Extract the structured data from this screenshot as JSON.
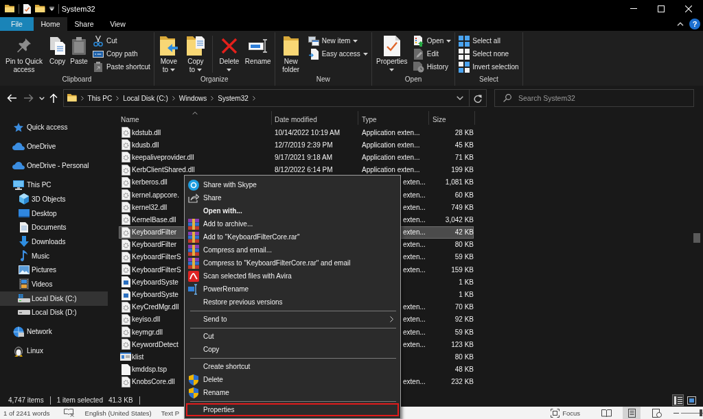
{
  "title_bar": {
    "title": "System32"
  },
  "ribbon_tabs": [
    {
      "label": "File",
      "kind": "file",
      "selected": false
    },
    {
      "label": "Home",
      "kind": "tab",
      "selected": true
    },
    {
      "label": "Share",
      "kind": "tab",
      "selected": false
    },
    {
      "label": "View",
      "kind": "tab",
      "selected": false
    }
  ],
  "help_button": {
    "label": "?"
  },
  "ribbon_groups": [
    {
      "label": "Clipboard",
      "items": [
        {
          "label": "Pin to Quick access",
          "kind": "large",
          "dropdown": false
        },
        {
          "label": "Copy",
          "kind": "large",
          "dropdown": false
        },
        {
          "label": "Paste",
          "kind": "large",
          "dropdown": false
        },
        {
          "label": "Cut",
          "kind": "small",
          "dropdown": false
        },
        {
          "label": "Copy path",
          "kind": "small",
          "dropdown": false
        },
        {
          "label": "Paste shortcut",
          "kind": "small",
          "dropdown": false
        }
      ]
    },
    {
      "label": "Organize",
      "items": [
        {
          "label": "Move to",
          "kind": "large",
          "dropdown": true
        },
        {
          "label": "Copy to",
          "kind": "large",
          "dropdown": true
        },
        {
          "label": "Delete",
          "kind": "large",
          "dropdown": true
        },
        {
          "label": "Rename",
          "kind": "large",
          "dropdown": false
        }
      ]
    },
    {
      "label": "New",
      "items": [
        {
          "label": "New folder",
          "kind": "large",
          "dropdown": false
        },
        {
          "label": "New item",
          "kind": "small",
          "dropdown": true
        },
        {
          "label": "Easy access",
          "kind": "small",
          "dropdown": true
        }
      ]
    },
    {
      "label": "Open",
      "items": [
        {
          "label": "Properties",
          "kind": "large",
          "dropdown": true
        },
        {
          "label": "Open",
          "kind": "small",
          "dropdown": true
        },
        {
          "label": "Edit",
          "kind": "small",
          "dropdown": false
        },
        {
          "label": "History",
          "kind": "small",
          "dropdown": false
        }
      ]
    },
    {
      "label": "Select",
      "items": [
        {
          "label": "Select all",
          "kind": "small",
          "dropdown": false
        },
        {
          "label": "Select none",
          "kind": "small",
          "dropdown": false
        },
        {
          "label": "Invert selection",
          "kind": "small",
          "dropdown": false
        }
      ]
    }
  ],
  "address_bar": {
    "path": [
      "This PC",
      "Local Disk (C:)",
      "Windows",
      "System32"
    ]
  },
  "search": {
    "placeholder": "Search System32"
  },
  "sidebar": {
    "items": [
      {
        "label": "Quick access",
        "selected": false
      },
      {
        "label": "OneDrive",
        "selected": false
      },
      {
        "label": "OneDrive - Personal",
        "selected": false
      },
      {
        "label": "This PC",
        "selected": false,
        "children": [
          {
            "label": "3D Objects",
            "selected": false
          },
          {
            "label": "Desktop",
            "selected": false
          },
          {
            "label": "Documents",
            "selected": false
          },
          {
            "label": "Downloads",
            "selected": false
          },
          {
            "label": "Music",
            "selected": false
          },
          {
            "label": "Pictures",
            "selected": false
          },
          {
            "label": "Videos",
            "selected": false
          },
          {
            "label": "Local Disk (C:)",
            "selected": true
          },
          {
            "label": "Local Disk (D:)",
            "selected": false
          }
        ]
      },
      {
        "label": "Network",
        "selected": false
      },
      {
        "label": "Linux",
        "selected": false
      }
    ]
  },
  "file_list": {
    "columns": [
      {
        "label": "Name",
        "sorted": true
      },
      {
        "label": "Date modified",
        "sorted": false
      },
      {
        "label": "Type",
        "sorted": false
      },
      {
        "label": "Size",
        "sorted": false
      }
    ],
    "rows": [
      {
        "kind": "dll",
        "name": "kdstub.dll",
        "date": "10/14/2022 10:19 AM",
        "type": "Application exten...",
        "size": "28 KB",
        "selected": false
      },
      {
        "kind": "dll",
        "name": "kdusb.dll",
        "date": "12/7/2019 2:39 PM",
        "type": "Application exten...",
        "size": "45 KB",
        "selected": false
      },
      {
        "kind": "dll",
        "name": "keepaliveprovider.dll",
        "date": "9/17/2021 9:18 AM",
        "type": "Application exten...",
        "size": "71 KB",
        "selected": false
      },
      {
        "kind": "dll",
        "name": "KerbClientShared.dll",
        "date": "8/12/2022 6:14 PM",
        "type": "Application exten...",
        "size": "199 KB",
        "selected": false
      },
      {
        "kind": "dll",
        "name": "kerberos.dll",
        "type": "exten...",
        "size": "1,081 KB",
        "selected": false
      },
      {
        "kind": "dll",
        "name": "kernel.appcore.",
        "type": "exten...",
        "size": "60 KB",
        "selected": false
      },
      {
        "kind": "dll",
        "name": "kernel32.dll",
        "type": "exten...",
        "size": "749 KB",
        "selected": false
      },
      {
        "kind": "dll",
        "name": "KernelBase.dll",
        "type": "exten...",
        "size": "3,042 KB",
        "selected": false
      },
      {
        "kind": "dll",
        "name": "KeyboardFilter",
        "type": "exten...",
        "size": "42 KB",
        "selected": true
      },
      {
        "kind": "dll",
        "name": "KeyboardFilter",
        "type": "exten...",
        "size": "80 KB",
        "selected": false
      },
      {
        "kind": "dll",
        "name": "KeyboardFilterS",
        "type": "exten...",
        "size": "59 KB",
        "selected": false
      },
      {
        "kind": "dll",
        "name": "KeyboardFilterS",
        "type": "exten...",
        "size": "159 KB",
        "selected": false
      },
      {
        "kind": "image",
        "name": "KeyboardSyste",
        "size": "1 KB",
        "selected": false
      },
      {
        "kind": "image",
        "name": "KeyboardSyste",
        "size": "1 KB",
        "selected": false
      },
      {
        "kind": "dll",
        "name": "KeyCredMgr.dll",
        "type": "exten...",
        "size": "70 KB",
        "selected": false
      },
      {
        "kind": "dll",
        "name": "keyiso.dll",
        "type": "exten...",
        "size": "92 KB",
        "selected": false
      },
      {
        "kind": "dll",
        "name": "keymgr.dll",
        "type": "exten...",
        "size": "59 KB",
        "selected": false
      },
      {
        "kind": "dll",
        "name": "KeywordDetect",
        "type": "exten...",
        "size": "123 KB",
        "selected": false
      },
      {
        "kind": "app",
        "name": "klist",
        "size": "80 KB",
        "selected": false
      },
      {
        "kind": "file",
        "name": "kmddsp.tsp",
        "size": "48 KB",
        "selected": false
      },
      {
        "kind": "dll",
        "name": "KnobsCore.dll",
        "type": "exten...",
        "size": "232 KB",
        "selected": false
      }
    ]
  },
  "context_menu": {
    "sections": [
      [
        {
          "label": "Share with Skype",
          "default": false,
          "submenu": false,
          "highlighted": false
        },
        {
          "label": "Share",
          "default": false,
          "submenu": false,
          "highlighted": false
        },
        {
          "label": "Open with...",
          "default": true,
          "submenu": false,
          "highlighted": false
        },
        {
          "label": "Add to archive...",
          "default": false,
          "submenu": false,
          "highlighted": false
        },
        {
          "label": "Add to \"KeyboardFilterCore.rar\"",
          "default": false,
          "submenu": false,
          "highlighted": false
        },
        {
          "label": "Compress and email...",
          "default": false,
          "submenu": false,
          "highlighted": false
        },
        {
          "label": "Compress to \"KeyboardFilterCore.rar\" and email",
          "default": false,
          "submenu": false,
          "highlighted": false
        },
        {
          "label": "Scan selected files with Avira",
          "default": false,
          "submenu": false,
          "highlighted": false
        },
        {
          "label": "PowerRename",
          "default": false,
          "submenu": false,
          "highlighted": false
        },
        {
          "label": "Restore previous versions",
          "default": false,
          "submenu": false,
          "highlighted": false
        }
      ],
      [
        {
          "label": "Send to",
          "default": false,
          "submenu": true,
          "highlighted": false
        }
      ],
      [
        {
          "label": "Cut",
          "default": false,
          "submenu": false,
          "highlighted": false
        },
        {
          "label": "Copy",
          "default": false,
          "submenu": false,
          "highlighted": false
        }
      ],
      [
        {
          "label": "Create shortcut",
          "default": false,
          "submenu": false,
          "highlighted": false
        },
        {
          "label": "Delete",
          "default": false,
          "submenu": false,
          "highlighted": false
        },
        {
          "label": "Rename",
          "default": false,
          "submenu": false,
          "highlighted": false
        }
      ],
      [
        {
          "label": "Properties",
          "default": false,
          "submenu": false,
          "highlighted": true
        }
      ]
    ]
  },
  "status_bar": {
    "item_count": "4,747 items",
    "selection": "1 item selected",
    "selection_size": "41.3 KB",
    "view_buttons": [
      {
        "selected": true
      },
      {
        "selected": false
      }
    ]
  },
  "word_status_bar": {
    "word_count": "1 of 2241 words",
    "language": "English (United States)",
    "status_text": "Text P",
    "focus": "Focus",
    "view_buttons": [
      {
        "selected": false
      },
      {
        "selected": true
      },
      {
        "selected": false
      }
    ],
    "zoom_slider": {
      "level": 0.9
    }
  }
}
